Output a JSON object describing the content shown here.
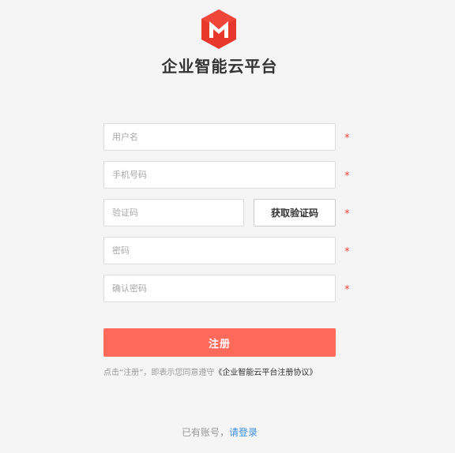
{
  "header": {
    "logo_icon": "m-hexagon-logo-icon",
    "logo_color": "#e8372b",
    "title": "企业智能云平台"
  },
  "form": {
    "username": {
      "value": "",
      "placeholder": "用户名"
    },
    "phone": {
      "value": "",
      "placeholder": "手机号码"
    },
    "verification_code": {
      "value": "",
      "placeholder": "验证码"
    },
    "password": {
      "value": "",
      "placeholder": "密码"
    },
    "confirm_password": {
      "value": "",
      "placeholder": "确认密码"
    },
    "required_mark": "*",
    "get_code_label": "获取验证码",
    "submit_label": "注册"
  },
  "agreement": {
    "prefix": "点击“注册”，即表示您同意遵守",
    "link": "《企业智能云平台注册协议》"
  },
  "footer": {
    "prompt": "已有账号，",
    "login_link": "请登录"
  },
  "colors": {
    "accent": "#ff6a5b",
    "required": "#e64b3c",
    "link": "#3d8fe0"
  }
}
